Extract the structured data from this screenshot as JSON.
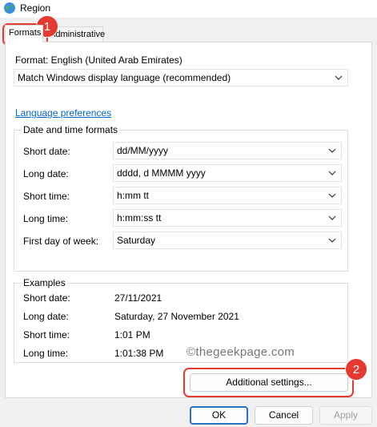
{
  "window": {
    "title": "Region",
    "icon": "globe-icon"
  },
  "tabs": [
    {
      "label": "Formats",
      "selected": true
    },
    {
      "label": "Administrative",
      "selected": false
    }
  ],
  "format": {
    "label": "Format: English (United Arab Emirates)",
    "selected": "Match Windows display language (recommended)"
  },
  "language_preferences_link": "Language preferences",
  "date_time_formats": {
    "title": "Date and time formats",
    "rows": [
      {
        "label": "Short date:",
        "value": "dd/MM/yyyy"
      },
      {
        "label": "Long date:",
        "value": "dddd, d MMMM yyyy"
      },
      {
        "label": "Short time:",
        "value": "h:mm tt"
      },
      {
        "label": "Long time:",
        "value": "h:mm:ss tt"
      },
      {
        "label": "First day of week:",
        "value": "Saturday"
      }
    ]
  },
  "examples": {
    "title": "Examples",
    "rows": [
      {
        "label": "Short date:",
        "value": "27/11/2021"
      },
      {
        "label": "Long date:",
        "value": "Saturday, 27 November 2021"
      },
      {
        "label": "Short time:",
        "value": "1:01 PM"
      },
      {
        "label": "Long time:",
        "value": "1:01:38 PM"
      }
    ]
  },
  "watermark": "©thegeekpage.com",
  "annotations": {
    "badge1": "1",
    "badge2": "2",
    "color": "#e53a2f"
  },
  "buttons": {
    "additional_settings": "Additional settings...",
    "ok": "OK",
    "cancel": "Cancel",
    "apply": "Apply"
  }
}
